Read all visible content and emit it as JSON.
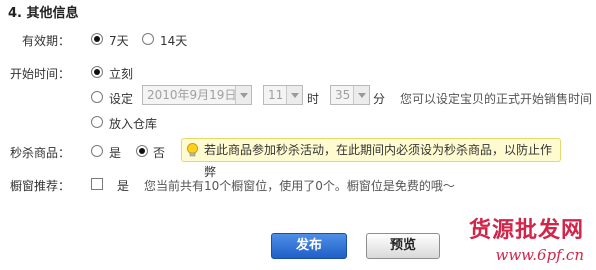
{
  "section": {
    "title": "4. 其他信息"
  },
  "validity": {
    "label": "有效期：",
    "options": [
      {
        "label": "7天",
        "checked": true
      },
      {
        "label": "14天",
        "checked": false
      }
    ]
  },
  "start_time": {
    "label": "开始时间：",
    "immediate": {
      "label": "立刻",
      "checked": true
    },
    "set": {
      "label": "设定",
      "checked": false,
      "date": "2010年9月19日",
      "hour": "11",
      "hour_unit": "时",
      "minute": "35",
      "minute_unit": "分",
      "hint": "您可以设定宝贝的正式开始销售时间"
    },
    "warehouse": {
      "label": "放入仓库",
      "checked": false
    }
  },
  "flash_sale": {
    "label": "秒杀商品：",
    "options": [
      {
        "label": "是",
        "checked": false
      },
      {
        "label": "否",
        "checked": true
      }
    ],
    "tip": "若此商品参加秒杀活动，在此期间内必须设为秒杀商品，以防止作弊"
  },
  "window_recommend": {
    "label": "橱窗推荐：",
    "checkbox_label": "是",
    "checked": false,
    "hint": "您当前共有10个橱窗位，使用了0个。橱窗位是免费的哦～"
  },
  "buttons": {
    "publish": "发布",
    "preview": "预览"
  },
  "watermark": {
    "text": "货源批发网",
    "url": "www.6pf.cn"
  },
  "colors": {
    "primary_button": "#2a6fd6",
    "tip_background": "#fffbd1",
    "watermark": "#d3254a"
  }
}
